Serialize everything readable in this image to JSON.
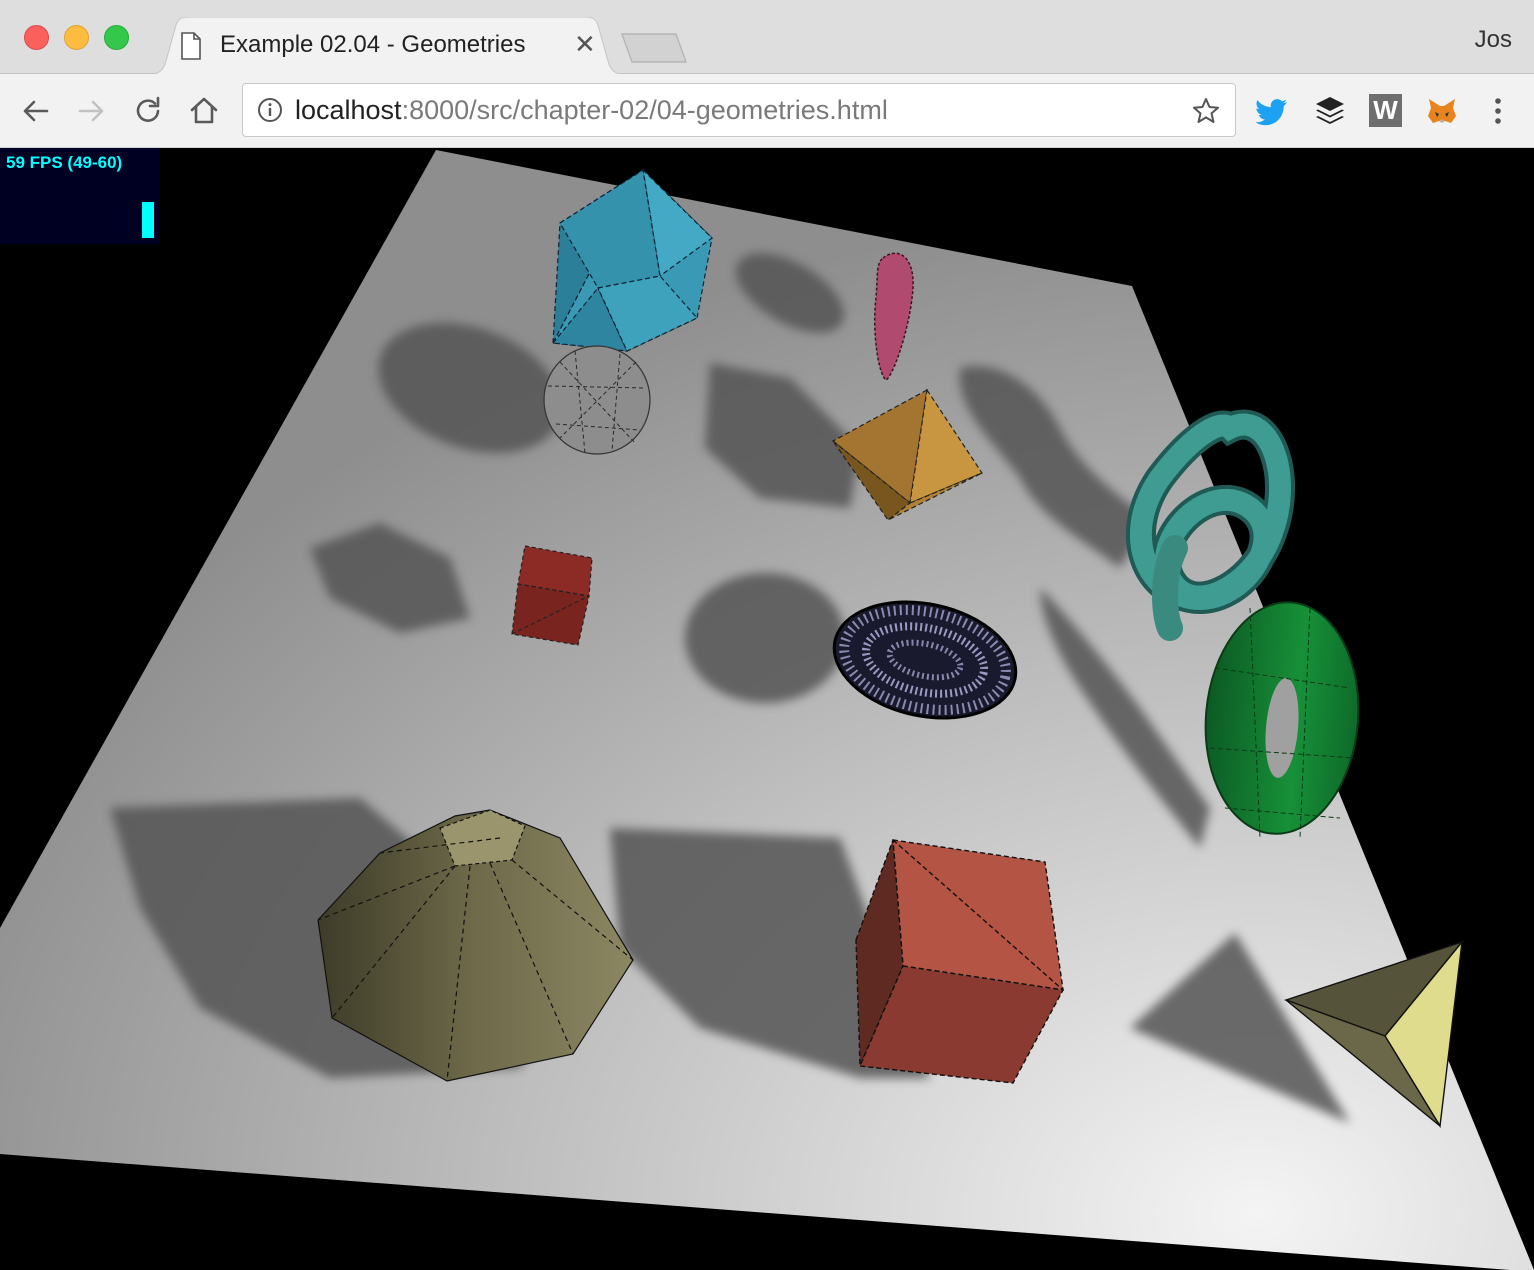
{
  "window": {
    "profile_name": "Jos"
  },
  "tab": {
    "title": "Example 02.04 - Geometries",
    "close_symbol": "✕"
  },
  "address_bar": {
    "host": "localhost",
    "path": ":8000/src/chapter-02/04-geometries.html"
  },
  "stats": {
    "fps_text": "59 FPS (49-60)",
    "fps_level": 0.6
  },
  "extensions": [
    "twitter-icon",
    "buffer-icon",
    "w-extension-icon",
    "metamask-icon"
  ],
  "extension_w_letter": "W",
  "colors": {
    "plane": "#c8c8c8",
    "icosahedron": "#3a9ab6",
    "sphere": "#909090",
    "torus_knot_small": "#b04a6e",
    "octahedron": "#c08c3c",
    "torus_knot": "#3a8a80",
    "box_small": "#8c2a26",
    "ellipsoid": "#1a1a2e",
    "torus": "#17883a",
    "cylinder": "#7c7754",
    "box_large": "#a84a3c",
    "tetrahedron": "#d8d48a",
    "stats_text": "#00ffff"
  }
}
